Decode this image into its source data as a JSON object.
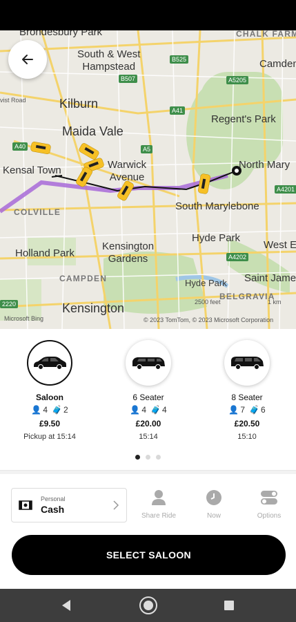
{
  "map": {
    "labels": {
      "brondesbury_park": "Brondesbury Park",
      "chalk_farm": "CHALK FARM",
      "south_west_hampstead": "South & West\nHampstead",
      "camden": "Camden",
      "kilburn": "Kilburn",
      "regents_park": "Regent's Park",
      "maida_vale": "Maida Vale",
      "warwick_avenue": "Warwick\nAvenue",
      "north_mary": "North Mary",
      "kensal_town": "Kensal Town",
      "colville": "COLVILLE",
      "south_marylebone": "South Marylebone",
      "holland_park": "Holland Park",
      "kensington_gardens": "Kensington\nGardens",
      "hyde_park": "Hyde Park",
      "west_end": "West E",
      "campden": "CAMPDEN",
      "hyde_park_small": "Hyde Park",
      "saint_james": "Saint Jame",
      "belgravia": "BELGRAVIA",
      "kensington": "Kensington",
      "scale_ft": "2500 feet",
      "scale_km": "1 km",
      "attribution": "© 2023 TomTom, © 2023 Microsoft Corporation",
      "bing": "Microsoft Bing",
      "road": "vist Road"
    },
    "road_tags": {
      "b525": "B525",
      "b507": "B507",
      "a5205": "A5205",
      "a41": "A41",
      "a40": "A40",
      "a5": "A5",
      "a4201": "A4201",
      "a4202": "A4202",
      "a5b": "A5",
      "a2220": "2220"
    }
  },
  "vehicles": [
    {
      "name": "Saloon",
      "passengers": "4",
      "luggage": "2",
      "price": "£9.50",
      "time": "Pickup at 15:14",
      "icon": "saloon-car-icon",
      "selected": true
    },
    {
      "name": "6 Seater",
      "passengers": "4",
      "luggage": "4",
      "price": "£20.00",
      "time": "15:14",
      "icon": "six-seater-van-icon",
      "selected": false
    },
    {
      "name": "8 Seater",
      "passengers": "7",
      "luggage": "6",
      "price": "£20.50",
      "time": "15:10",
      "icon": "eight-seater-van-icon",
      "selected": false
    }
  ],
  "payment": {
    "type": "Personal",
    "method": "Cash"
  },
  "options": {
    "share_ride": "Share Ride",
    "now": "Now",
    "options": "Options"
  },
  "select_button": "SELECT SALOON",
  "colors": {
    "accent": "#000000",
    "route": "#9b59d0",
    "taxi": "#f6c026"
  }
}
